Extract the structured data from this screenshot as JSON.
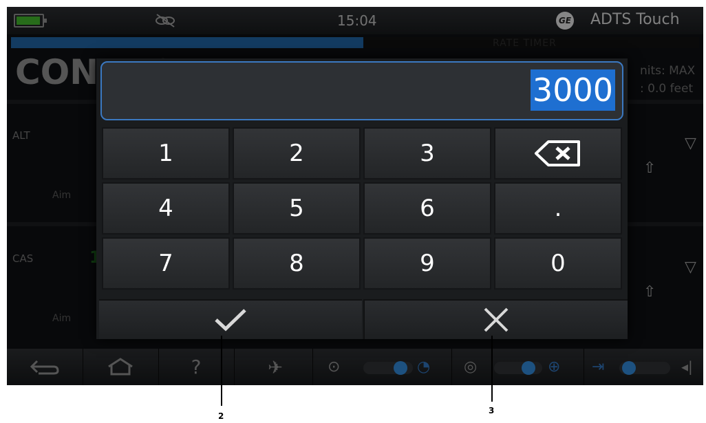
{
  "status_bar": {
    "time": "15:04",
    "app_name": "ADTS Touch",
    "brand_logo": "GE"
  },
  "progress_bar": {
    "label": "RATE TIMER",
    "fraction": 0.5
  },
  "background": {
    "title": "CONTROL",
    "units_line1": "nits: MAX",
    "units_line2": ": 0.0 feet",
    "rows": [
      {
        "label": "ALT",
        "aim": "Aim"
      },
      {
        "label": "CAS",
        "aim": "Aim",
        "value_fragment": "1"
      }
    ]
  },
  "keypad_dialog": {
    "entry_value": "3000",
    "keys": [
      "1",
      "2",
      "3",
      "4",
      "5",
      "6",
      ".",
      "7",
      "8",
      "9",
      "0"
    ],
    "actions": {
      "confirm": "check-icon",
      "cancel": "close-icon"
    }
  },
  "toolbar": {
    "items": [
      "back-icon",
      "home-icon",
      "help-icon",
      "aircraft-landing-icon",
      "pitot-toggle",
      "static-toggle",
      "leak-toggle"
    ]
  },
  "callouts": {
    "confirm_number": "2",
    "cancel_number": "3"
  },
  "colors": {
    "accent_blue": "#1e6fd1",
    "battery_green": "#3fae2a",
    "progress_blue": "#1f5f9d"
  }
}
